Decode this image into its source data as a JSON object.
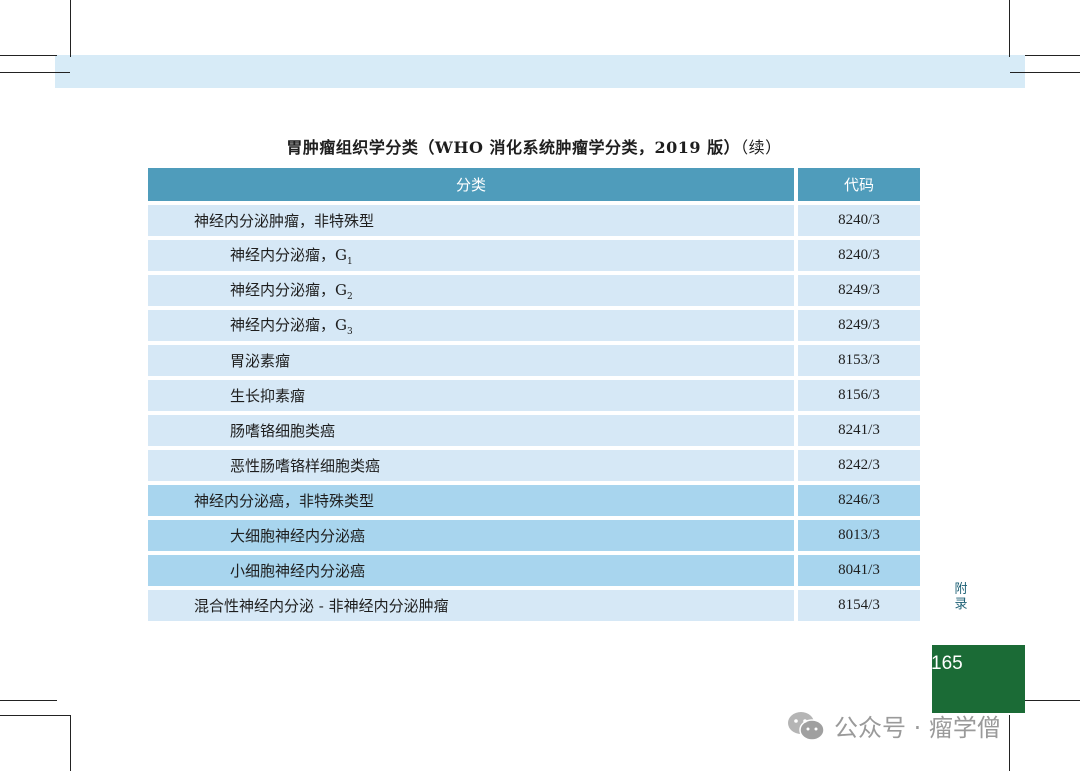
{
  "title": {
    "main": "胃肿瘤组织学分类（WHO 消化系统肿瘤学分类，2019 版）",
    "cont": "（续）"
  },
  "table": {
    "headers": [
      "分类",
      "代码"
    ],
    "rows": [
      {
        "label": "神经内分泌肿瘤，非特殊型",
        "sub": "",
        "code": "8240/3"
      },
      {
        "label": "神经内分泌瘤，G",
        "sub": "1",
        "code": "8240/3"
      },
      {
        "label": "神经内分泌瘤，G",
        "sub": "2",
        "code": "8249/3"
      },
      {
        "label": "神经内分泌瘤，G",
        "sub": "3",
        "code": "8249/3"
      },
      {
        "label": "胃泌素瘤",
        "sub": "",
        "code": "8153/3"
      },
      {
        "label": "生长抑素瘤",
        "sub": "",
        "code": "8156/3"
      },
      {
        "label": "肠嗜铬细胞类癌",
        "sub": "",
        "code": "8241/3"
      },
      {
        "label": "恶性肠嗜铬样细胞类癌",
        "sub": "",
        "code": "8242/3"
      },
      {
        "label": "神经内分泌癌，非特殊类型",
        "sub": "",
        "code": "8246/3"
      },
      {
        "label": "大细胞神经内分泌癌",
        "sub": "",
        "code": "8013/3"
      },
      {
        "label": "小细胞神经内分泌癌",
        "sub": "",
        "code": "8041/3"
      },
      {
        "label": "混合性神经内分泌 - 非神经内分泌肿瘤",
        "sub": "",
        "code": "8154/3"
      }
    ]
  },
  "side_label": "附录",
  "page_number": "165",
  "watermark": "公众号 · 瘤学僧",
  "colors": {
    "header": "#4f9cbb",
    "row_light": "#d6e8f6",
    "row_dark": "#a8d5ee",
    "page_box": "#1b6b36",
    "top_band": "#d7ebf7"
  }
}
